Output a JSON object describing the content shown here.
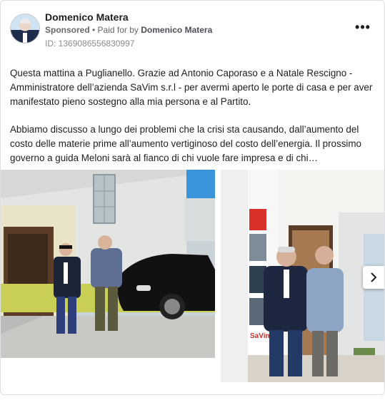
{
  "post": {
    "author": "Domenico Matera",
    "sponsored_label": "Sponsored",
    "separator": " • ",
    "paid_for_prefix": "Paid for by ",
    "paid_for_by": "Domenico Matera",
    "ad_id": "ID: 1369086556830997",
    "more_icon": "more-options-icon",
    "text_paragraphs": [
      "Questa mattina a Puglianello. Grazie ad Antonio Caporaso e a Natale Rescigno - Amministratore dell’azienda SaVim s.r.l - per avermi aperto le porte di casa e per aver manifestato pieno sostegno alla mia persona e al Partito.",
      "Abbiamo discusso a lungo dei problemi che la crisi sta causando, dall’aumento del costo delle materie prime all’aumento vertiginoso del costo dell’energia. Il prossimo governo a guida Meloni sarà al fianco di chi vuole fare impresa e di chi…"
    ]
  },
  "carousel": {
    "next_icon": "chevron-right-icon",
    "photo2_sign": "SaVim"
  },
  "colors": {
    "text": "#1c1e21",
    "secondary": "#65676b",
    "border": "#dddfe2"
  }
}
